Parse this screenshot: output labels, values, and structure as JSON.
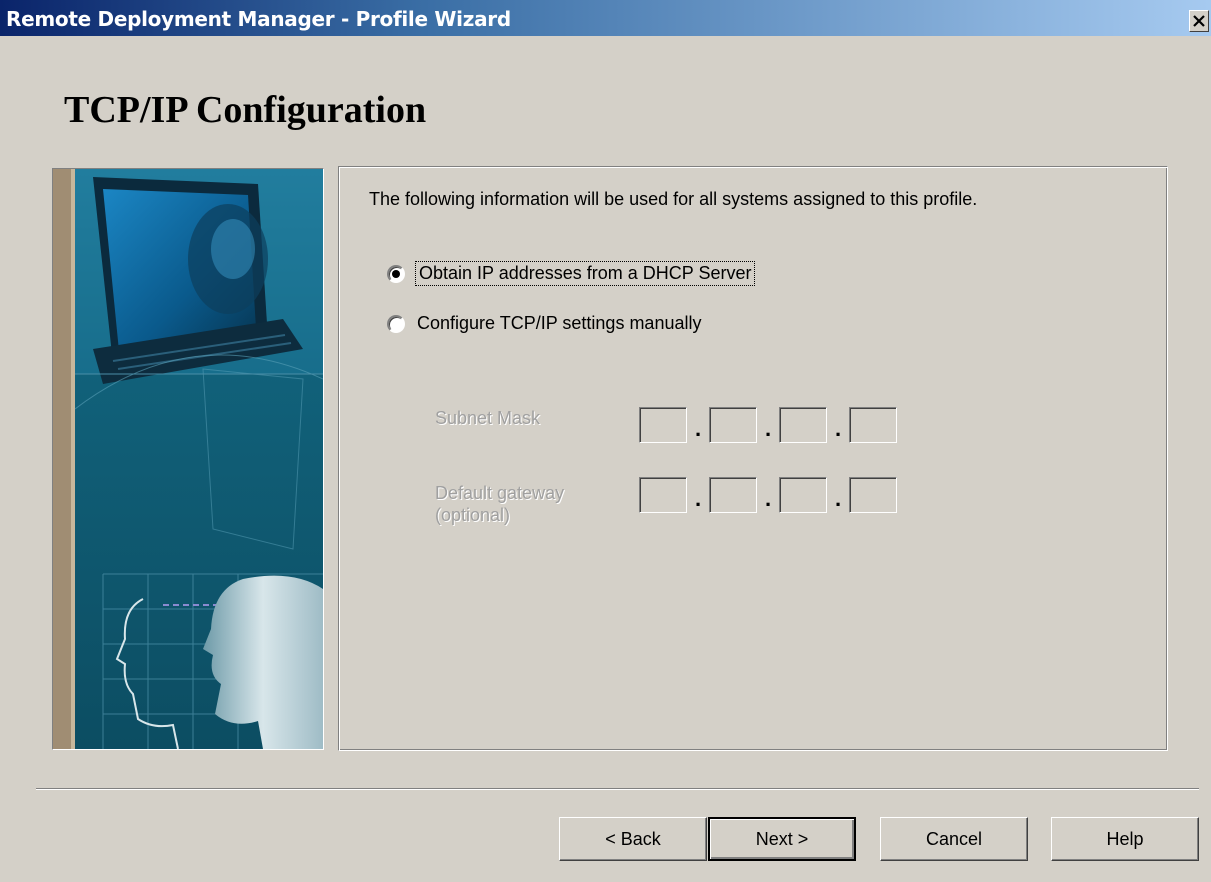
{
  "window": {
    "title": "Remote Deployment Manager - Profile Wizard"
  },
  "page": {
    "heading": "TCP/IP Configuration"
  },
  "content": {
    "info_text": "The following information will be used for all systems assigned to this profile.",
    "options": [
      {
        "label": "Obtain IP addresses from a DHCP Server",
        "selected": true
      },
      {
        "label": "Configure TCP/IP settings manually",
        "selected": false
      }
    ],
    "subnet_mask": {
      "label": "Subnet Mask",
      "octets": [
        "",
        "",
        "",
        ""
      ],
      "enabled": false
    },
    "default_gateway": {
      "label_line1": "Default gateway",
      "label_line2": "(optional)",
      "octets": [
        "",
        "",
        "",
        ""
      ],
      "enabled": false
    }
  },
  "buttons": {
    "back": "< Back",
    "next": "Next >",
    "cancel": "Cancel",
    "help": "Help"
  },
  "colors": {
    "title_gradient_start": "#0a246a",
    "title_gradient_end": "#a6caf0",
    "dialog_background": "#d4d0c8",
    "disabled_text": "#a0a0a0",
    "banner_teal": "#0f5a72"
  },
  "icons": {
    "close": "close-icon",
    "banner": "computer-and-faces-illustration"
  }
}
